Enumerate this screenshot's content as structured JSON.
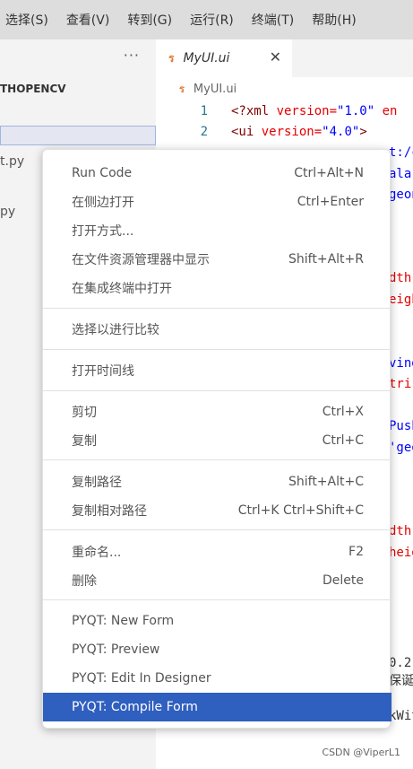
{
  "menubar": {
    "items": [
      "选择(S)",
      "查看(V)",
      "转到(G)",
      "运行(R)",
      "终端(T)",
      "帮助(H)"
    ]
  },
  "sidebar": {
    "more_icon": "···",
    "folder_name": "THOPENCV",
    "files": [
      "t.py",
      "py"
    ]
  },
  "editor": {
    "tab": {
      "icon": "rss-icon",
      "name": "MyUI.ui",
      "close_icon": "✕"
    },
    "breadcrumb": {
      "icon": "rss-icon",
      "name": "MyUI.ui"
    },
    "lines": [
      {
        "num": "1",
        "tag_open": "<?xml ",
        "attr": "version=",
        "str": "\"1.0\"",
        "rest": " en"
      },
      {
        "num": "2",
        "tag_open": "<ui ",
        "attr": "version=",
        "str": "\"4.0\"",
        "rest": ">"
      }
    ],
    "fragments": [
      "t:/cl",
      "ala",
      "geon",
      "dth:",
      "eigh",
      "vind",
      "trir",
      "Push",
      "'geo",
      "dth",
      "heig",
      "0.2",
      "保诞",
      "kWit"
    ]
  },
  "context_menu": {
    "groups": [
      [
        {
          "label": "Run Code",
          "shortcut": "Ctrl+Alt+N"
        },
        {
          "label": "在侧边打开",
          "shortcut": "Ctrl+Enter"
        },
        {
          "label": "打开方式...",
          "shortcut": ""
        },
        {
          "label": "在文件资源管理器中显示",
          "shortcut": "Shift+Alt+R"
        },
        {
          "label": "在集成终端中打开",
          "shortcut": ""
        }
      ],
      [
        {
          "label": "选择以进行比较",
          "shortcut": ""
        }
      ],
      [
        {
          "label": "打开时间线",
          "shortcut": ""
        }
      ],
      [
        {
          "label": "剪切",
          "shortcut": "Ctrl+X"
        },
        {
          "label": "复制",
          "shortcut": "Ctrl+C"
        }
      ],
      [
        {
          "label": "复制路径",
          "shortcut": "Shift+Alt+C"
        },
        {
          "label": "复制相对路径",
          "shortcut": "Ctrl+K Ctrl+Shift+C"
        }
      ],
      [
        {
          "label": "重命名...",
          "shortcut": "F2"
        },
        {
          "label": "删除",
          "shortcut": "Delete"
        }
      ],
      [
        {
          "label": "PYQT: New Form",
          "shortcut": ""
        },
        {
          "label": "PYQT: Preview",
          "shortcut": ""
        },
        {
          "label": "PYQT: Edit In Designer",
          "shortcut": ""
        },
        {
          "label": "PYQT: Compile Form",
          "shortcut": ""
        }
      ]
    ],
    "active_label": "PYQT: Compile Form"
  },
  "watermark": "CSDN @ViperL1",
  "colors": {
    "accent": "#2f5fbf",
    "menubar_bg": "#dddddd",
    "rss_icon": "#e37933"
  }
}
